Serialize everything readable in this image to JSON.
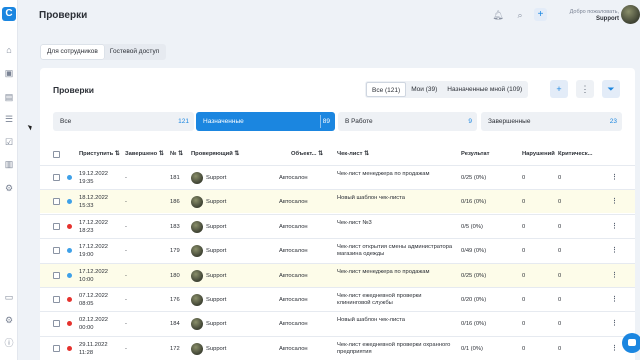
{
  "app": {
    "logo_text": "C",
    "accent": "#1b86e0"
  },
  "sidebar": {
    "icons": [
      "home-icon",
      "calendar-icon",
      "clipboard-icon",
      "list-icon",
      "checklist-icon",
      "bar-chart-icon",
      "settings-cog-icon",
      "card-icon",
      "gear-icon",
      "info-icon"
    ]
  },
  "header": {
    "title": "Проверки",
    "welcome": "Добро пожаловать,",
    "user": "Support",
    "plus": "+"
  },
  "access_tabs": [
    "Для сотрудников",
    "Гостевой доступ"
  ],
  "card": {
    "title": "Проверки",
    "filters": [
      "Все (121)",
      "Мои (39)",
      "Назначенные мной (109)"
    ]
  },
  "status": [
    {
      "label": "Все",
      "count": "121"
    },
    {
      "label": "Назначенные",
      "count": "89"
    },
    {
      "label": "В Работе",
      "count": "9"
    },
    {
      "label": "Завершенные",
      "count": "23"
    }
  ],
  "columns": {
    "start": "Приступить",
    "done": "Завершено",
    "num": "№",
    "inspector": "Проверяющий",
    "object": "Объект...",
    "checklist": "Чек-лист",
    "result": "Результат",
    "violations": "Нарушений",
    "critical": "Критическ..."
  },
  "rows": [
    {
      "date": "19.12.2022",
      "time": "19:35",
      "status": "#3ea0e8",
      "done": "-",
      "num": "181",
      "inspector": "Support",
      "object": "Автосалон",
      "checklist": "Чек-лист менеджера по продажам",
      "result": "0/25 (0%)",
      "violations": "0",
      "critical": "0"
    },
    {
      "date": "18.12.2022",
      "time": "15:33",
      "status": "#3ea0e8",
      "done": "-",
      "num": "186",
      "inspector": "Support",
      "object": "Автосалон",
      "checklist": "Новый шаблон чек-листа",
      "result": "0/16 (0%)",
      "violations": "0",
      "critical": "0"
    },
    {
      "date": "17.12.2022",
      "time": "18:23",
      "status": "#e5322d",
      "done": "-",
      "num": "183",
      "inspector": "Support",
      "object": "Автосалон",
      "checklist": "Чек-лист №3",
      "result": "0/5 (0%)",
      "violations": "0",
      "critical": "0"
    },
    {
      "date": "17.12.2022",
      "time": "19:00",
      "status": "#3ea0e8",
      "done": "-",
      "num": "179",
      "inspector": "Support",
      "object": "Автосалон",
      "checklist": "Чек-лист открытия смены администратора магазина одежды",
      "result": "0/49 (0%)",
      "violations": "0",
      "critical": "0"
    },
    {
      "date": "17.12.2022",
      "time": "10:00",
      "status": "#3ea0e8",
      "done": "-",
      "num": "180",
      "inspector": "Support",
      "object": "Автосалон",
      "checklist": "Чек-лист менеджера по продажам",
      "result": "0/25 (0%)",
      "violations": "0",
      "critical": "0"
    },
    {
      "date": "07.12.2022",
      "time": "08:05",
      "status": "#e5322d",
      "done": "-",
      "num": "176",
      "inspector": "Support",
      "object": "Автосалон",
      "checklist": "Чек-лист ежедневной проверки клининговой службы",
      "result": "0/20 (0%)",
      "violations": "0",
      "critical": "0"
    },
    {
      "date": "02.12.2022",
      "time": "00:00",
      "status": "#e5322d",
      "done": "-",
      "num": "184",
      "inspector": "Support",
      "object": "Автосалон",
      "checklist": "Новый шаблон чек-листа",
      "result": "0/16 (0%)",
      "violations": "0",
      "critical": "0"
    },
    {
      "date": "29.11.2022",
      "time": "11:28",
      "status": "#e5322d",
      "done": "-",
      "num": "172",
      "inspector": "Support",
      "object": "Автосалон",
      "checklist": "Чек-лист ежедневной проверки охранного предприятия",
      "result": "0/1 (0%)",
      "violations": "0",
      "critical": "0"
    }
  ]
}
